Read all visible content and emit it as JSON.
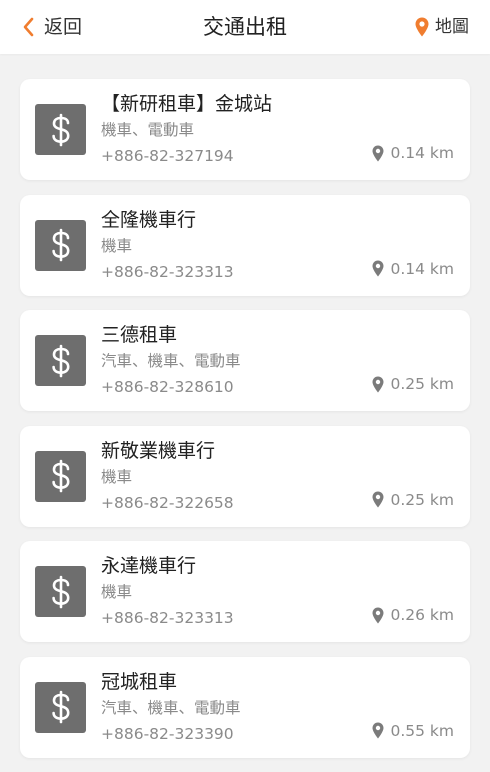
{
  "header": {
    "back_label": "返回",
    "title": "交通出租",
    "map_label": "地圖",
    "accent_color": "#f07d2f"
  },
  "icons": {
    "back": "chevron-left-icon",
    "map": "map-pin-icon",
    "item": "dollar-sign-icon",
    "distance": "location-pin-icon"
  },
  "items": [
    {
      "name": "【新研租車】金城站",
      "type": "機車、電動車",
      "phone": "+886-82-327194",
      "distance": "0.14 km"
    },
    {
      "name": "全隆機車行",
      "type": "機車",
      "phone": "+886-82-323313",
      "distance": "0.14 km"
    },
    {
      "name": "三德租車",
      "type": "汽車、機車、電動車",
      "phone": "+886-82-328610",
      "distance": "0.25 km"
    },
    {
      "name": "新敬業機車行",
      "type": "機車",
      "phone": "+886-82-322658",
      "distance": "0.25 km"
    },
    {
      "name": "永達機車行",
      "type": "機車",
      "phone": "+886-82-323313",
      "distance": "0.26 km"
    },
    {
      "name": "冠城租車",
      "type": "汽車、機車、電動車",
      "phone": "+886-82-323390",
      "distance": "0.55 km"
    }
  ]
}
